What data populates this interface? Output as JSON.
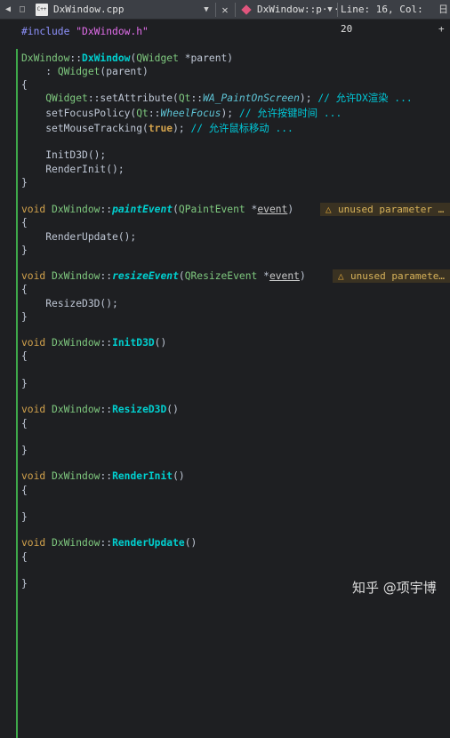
{
  "toolbar": {
    "file_name": "DxWindow.cpp",
    "symbol_name": "DxWindow::p···",
    "cursor_position": "Line: 16, Col: 20",
    "split_label": "日+"
  },
  "editor": {
    "include_directive": "#include",
    "include_file": "\"DxWindow.h\"",
    "class_name": "DxWindow",
    "widget_class": "QWidget",
    "parent_param": "*parent",
    "set_attribute_call": "::setAttribute(",
    "qt_ns": "Qt",
    "attr_enum": "WA_PaintOnScreen",
    "comment_1": "// 允许DX渲染 ...",
    "set_focus_call": "setFocusPolicy(",
    "focus_enum": "WheelFocus",
    "comment_2": "// 允许按键时间 ...",
    "set_mouse_call": "setMouseTracking(",
    "true_kw": "true",
    "comment_3": "// 允许鼠标移动 ...",
    "init_call": "InitD3D();",
    "render_init_call": "RenderInit();",
    "void_kw": "void",
    "paint_event": "paintEvent",
    "qpaint_event": "QPaintEvent",
    "event_param": "event",
    "render_update_call": "RenderUpdate();",
    "resize_event": "resizeEvent",
    "qresize_event": "QResizeEvent",
    "resize_call": "ResizeD3D();",
    "fn_init": "InitD3D",
    "fn_resize": "ResizeD3D",
    "fn_render_init": "RenderInit",
    "fn_render_update": "RenderUpdate",
    "warning_1": "unused parameter …",
    "warning_2": "unused paramete…"
  },
  "watermark": "知乎 @项宇博",
  "colors": {
    "background": "#1e1f22",
    "keyword": "#d2a24c",
    "class": "#7fc97f",
    "function": "#00d0d0",
    "string": "#e36eec",
    "warning_bg": "#3a3222",
    "gutter_change": "#3ea84a"
  }
}
